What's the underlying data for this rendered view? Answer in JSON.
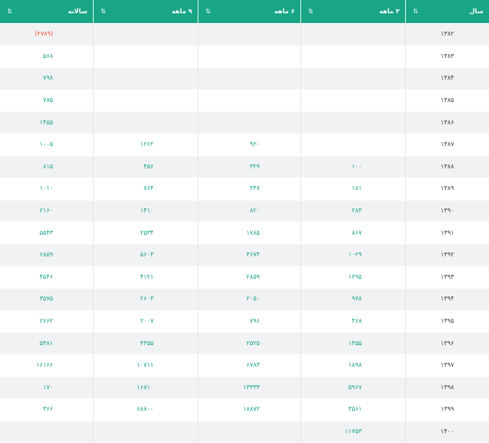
{
  "headers": [
    {
      "label": "سال",
      "icon": "sort-icon"
    },
    {
      "label": "۳ ماهه",
      "icon": "sort-icon"
    },
    {
      "label": "۶ ماهه",
      "icon": "sort-icon"
    },
    {
      "label": "۹ ماهه",
      "icon": "sort-icon"
    },
    {
      "label": "سالانه",
      "icon": "sort-icon"
    }
  ],
  "sort_glyph": "⇅",
  "rows": [
    {
      "year": "۱۳۸۲",
      "q3": "",
      "q6": "",
      "q9": "",
      "annual": "(۲۷۸۹)",
      "annual_negative": true
    },
    {
      "year": "۱۳۸۳",
      "q3": "",
      "q6": "",
      "q9": "",
      "annual": "۵۶۸"
    },
    {
      "year": "۱۳۸۴",
      "q3": "",
      "q6": "",
      "q9": "",
      "annual": "۷۹۸"
    },
    {
      "year": "۱۳۸۵",
      "q3": "",
      "q6": "",
      "q9": "",
      "annual": "۷۸۵"
    },
    {
      "year": "۱۳۸۶",
      "q3": "",
      "q6": "",
      "q9": "",
      "annual": "۱۴۵۵"
    },
    {
      "year": "۱۳۸۷",
      "q3": "",
      "q6": "۹۲۰",
      "q9": "۱۲۶۲",
      "annual": "۱۰۰۵"
    },
    {
      "year": "۱۳۸۸",
      "q3": "۱۰۰",
      "q6": "۳۲۹",
      "q9": "۴۵۶",
      "annual": "۸۱۵"
    },
    {
      "year": "۱۳۸۹",
      "q3": "۱۸۱",
      "q6": "۴۴۷",
      "q9": "۷۶۴",
      "annual": "۱۰۱۰"
    },
    {
      "year": "۱۳۹۰",
      "q3": "۲۸۳",
      "q6": "۸۲۰",
      "q9": "۱۴۱۰",
      "annual": "۲۱۶۰"
    },
    {
      "year": "۱۳۹۱",
      "q3": "۸۶۷",
      "q6": "۱۷۸۵",
      "q9": "۲۵۳۴",
      "annual": "۵۵۴۳"
    },
    {
      "year": "۱۳۹۲",
      "q3": "۱۰۲۹",
      "q6": "۳۶۷۴",
      "q9": "۵۶۰۳",
      "annual": "۶۸۵۹"
    },
    {
      "year": "۱۳۹۳",
      "q3": "۱۲۹۵",
      "q6": "۲۸۵۹",
      "q9": "۴۱۲۱",
      "annual": "۴۵۴۶"
    },
    {
      "year": "۱۳۹۴",
      "q3": "۹۷۸",
      "q6": "۲۰۵۰",
      "q9": "۲۶۰۳",
      "annual": "۳۵۷۵"
    },
    {
      "year": "۱۳۹۵",
      "q3": "۴۶۸",
      "q6": "۷۹۶",
      "q9": "۲۰۰۷",
      "annual": "۲۶۶۲"
    },
    {
      "year": "۱۳۹۶",
      "q3": "۱۴۵۵",
      "q6": "۲۵۲۵",
      "q9": "۴۳۵۵",
      "annual": "۵۴۸۱"
    },
    {
      "year": "۱۳۹۷",
      "q3": "۱۸۹۸",
      "q6": "۶۷۸۳",
      "q9": "۱۰۷۱۱",
      "annual": "۱۶۱۶۶"
    },
    {
      "year": "۱۳۹۸",
      "q3": "۵۹۶۷",
      "q6": "۱۳۳۳۳",
      "q9": "۱۶۸۱۰",
      "annual": "۱۷۰"
    },
    {
      "year": "۱۳۹۹",
      "q3": "۳۵۶۱",
      "q6": "۱۸۸۷۲",
      "q9": "۶۸۸۰۰",
      "annual": "۳۶۶"
    },
    {
      "year": "۱۴۰۰",
      "q3": "۱۱۷۵۳",
      "q6": "",
      "q9": "",
      "annual": ""
    }
  ],
  "colors": {
    "header_bg": "#18a686",
    "value_text": "#1aa38a",
    "negative_text": "#f0532b",
    "stripe": "#f1f2f3"
  }
}
